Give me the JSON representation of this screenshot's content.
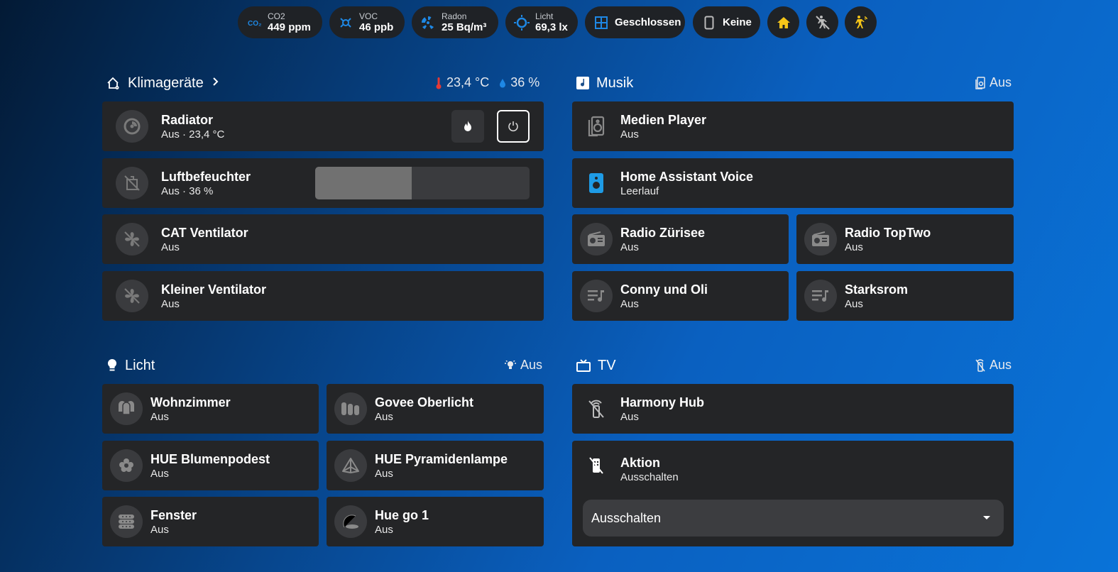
{
  "chips": {
    "co2": {
      "label": "CO2",
      "value": "449 ppm",
      "icon": "co2-icon"
    },
    "voc": {
      "label": "VOC",
      "value": "46 ppb",
      "icon": "voc-icon"
    },
    "radon": {
      "label": "Radon",
      "value": "25 Bq/m³",
      "icon": "radiation-icon"
    },
    "licht": {
      "label": "Licht",
      "value": "69,3 lx",
      "icon": "sun-icon"
    },
    "window": {
      "value": "Geschlossen",
      "icon": "window-icon"
    },
    "phone": {
      "value": "Keine",
      "icon": "phone-icon"
    },
    "home": {
      "icon": "home-icon",
      "color": "#f5c518"
    },
    "motion_off": {
      "icon": "motion-off-icon"
    },
    "motion": {
      "icon": "motion-icon",
      "color": "#f5c518"
    }
  },
  "klima": {
    "title": "Klimageräte",
    "temp": "23,4 °C",
    "humidity": "36 %",
    "cards": [
      {
        "name": "Radiator",
        "state": "Aus · 23,4 °C"
      },
      {
        "name": "Luftbefeuchter",
        "state": "Aus · 36 %",
        "level": 0.45
      },
      {
        "name": "CAT Ventilator",
        "state": "Aus"
      },
      {
        "name": "Kleiner Ventilator",
        "state": "Aus"
      }
    ]
  },
  "musik": {
    "title": "Musik",
    "status": "Aus",
    "cards": [
      {
        "name": "Medien Player",
        "state": "Aus"
      },
      {
        "name": "Home Assistant Voice",
        "state": "Leerlauf"
      },
      {
        "name": "Radio Zürisee",
        "state": "Aus"
      },
      {
        "name": "Radio TopTwo",
        "state": "Aus"
      },
      {
        "name": "Conny und Oli",
        "state": "Aus"
      },
      {
        "name": "Starksrom",
        "state": "Aus"
      }
    ]
  },
  "licht": {
    "title": "Licht",
    "status": "Aus",
    "cards": [
      {
        "name": "Wohnzimmer",
        "state": "Aus"
      },
      {
        "name": "Govee Oberlicht",
        "state": "Aus"
      },
      {
        "name": "HUE Blumenpodest",
        "state": "Aus"
      },
      {
        "name": "HUE Pyramidenlampe",
        "state": "Aus"
      },
      {
        "name": "Fenster",
        "state": "Aus"
      },
      {
        "name": "Hue go 1",
        "state": "Aus"
      }
    ]
  },
  "tv": {
    "title": "TV",
    "status": "Aus",
    "cards": [
      {
        "name": "Harmony Hub",
        "state": "Aus"
      },
      {
        "name": "Aktion",
        "state": "Ausschalten"
      }
    ],
    "select_value": "Ausschalten"
  },
  "colors": {
    "accent": "#1e88e5",
    "yellow": "#f5c518",
    "red": "#e53935"
  }
}
